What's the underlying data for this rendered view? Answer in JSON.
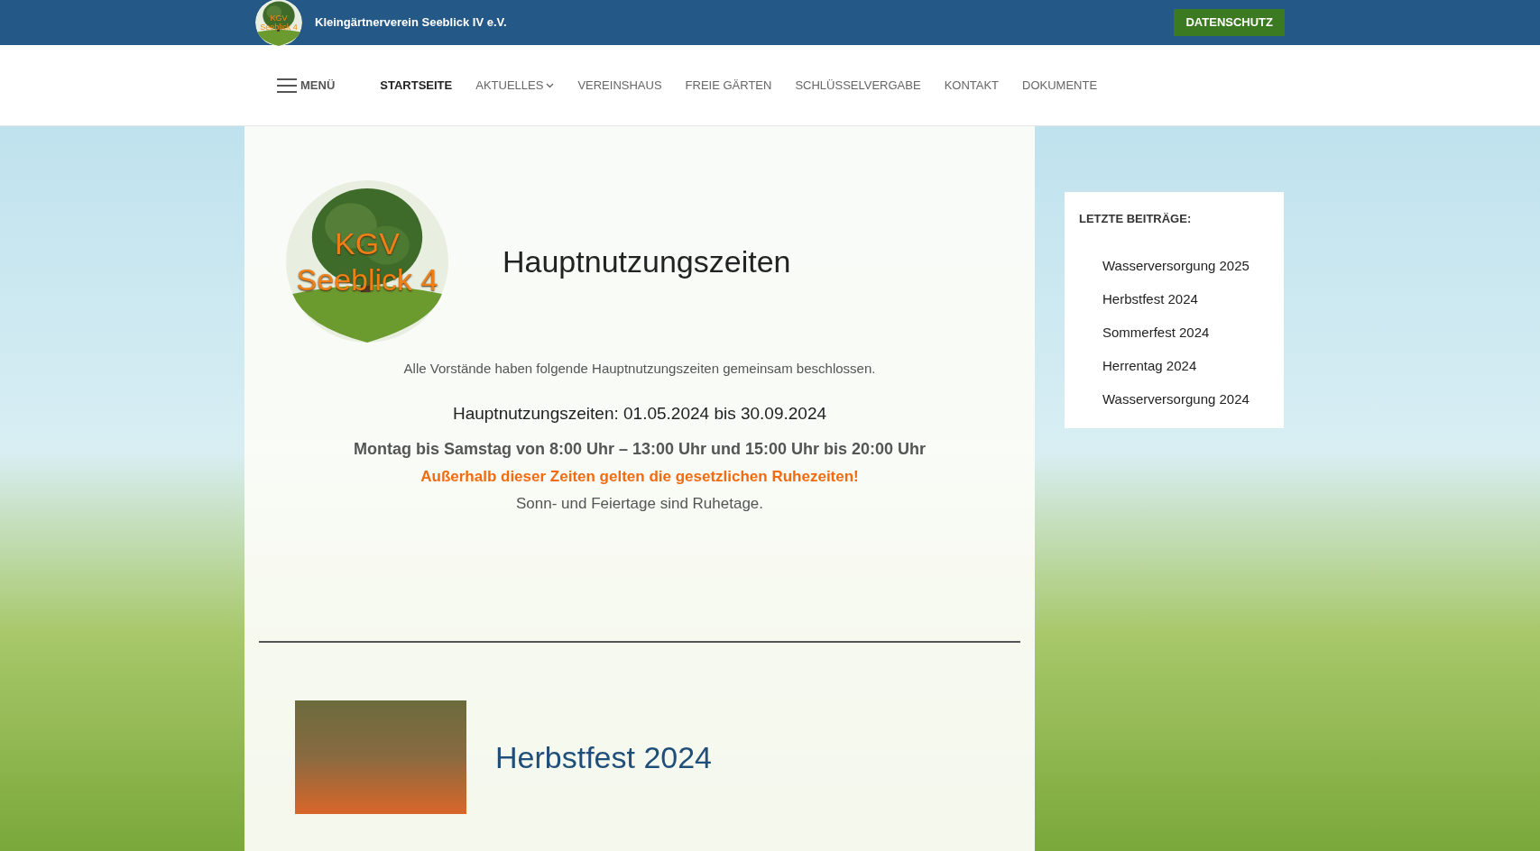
{
  "top_bar": {
    "logo_text": [
      "KGV",
      "Seeblick 4"
    ],
    "site_name": "Kleingärtnerverein Seeblick IV e.V.",
    "button": "DATENSCHUTZ"
  },
  "nav": {
    "menu_label": "MENÜ",
    "items": [
      {
        "label": "STARTSEITE",
        "selected": true,
        "has_submenu": false
      },
      {
        "label": "AKTUELLES",
        "selected": false,
        "has_submenu": true
      },
      {
        "label": "VEREINSHAUS",
        "selected": false,
        "has_submenu": false
      },
      {
        "label": "FREIE GÄRTEN",
        "selected": false,
        "has_submenu": false
      },
      {
        "label": "SCHLÜSSELVERGABE",
        "selected": false,
        "has_submenu": false
      },
      {
        "label": "KONTAKT",
        "selected": false,
        "has_submenu": false
      },
      {
        "label": "DOKUMENTE",
        "selected": false,
        "has_submenu": false
      }
    ]
  },
  "article": {
    "logo_text": [
      "KGV",
      "Seeblick 4"
    ],
    "title": "Hauptnutzungszeiten",
    "intro": "Alle Vorstände haben folgende Hauptnutzungszeiten gemeinsam beschlossen.",
    "period": "Hauptnutzungszeiten: 01.05.2024 bis 30.09.2024",
    "hours": "Montag bis Samstag von 8:00 Uhr – 13:00 Uhr und 15:00 Uhr bis 20:00 Uhr",
    "warning": "Außerhalb dieser Zeiten gelten die gesetzlichen Ruhezeiten!",
    "note": "Sonn- und Feiertage sind Ruhetage."
  },
  "next_post": {
    "title": "Herbstfest 2024"
  },
  "sidebar": {
    "title": "LETZTE BEITRÄGE:",
    "items": [
      "Wasserversorgung 2025",
      "Herbstfest 2024",
      "Sommerfest 2024",
      "Herrentag 2024",
      "Wasserversorgung 2024"
    ]
  }
}
